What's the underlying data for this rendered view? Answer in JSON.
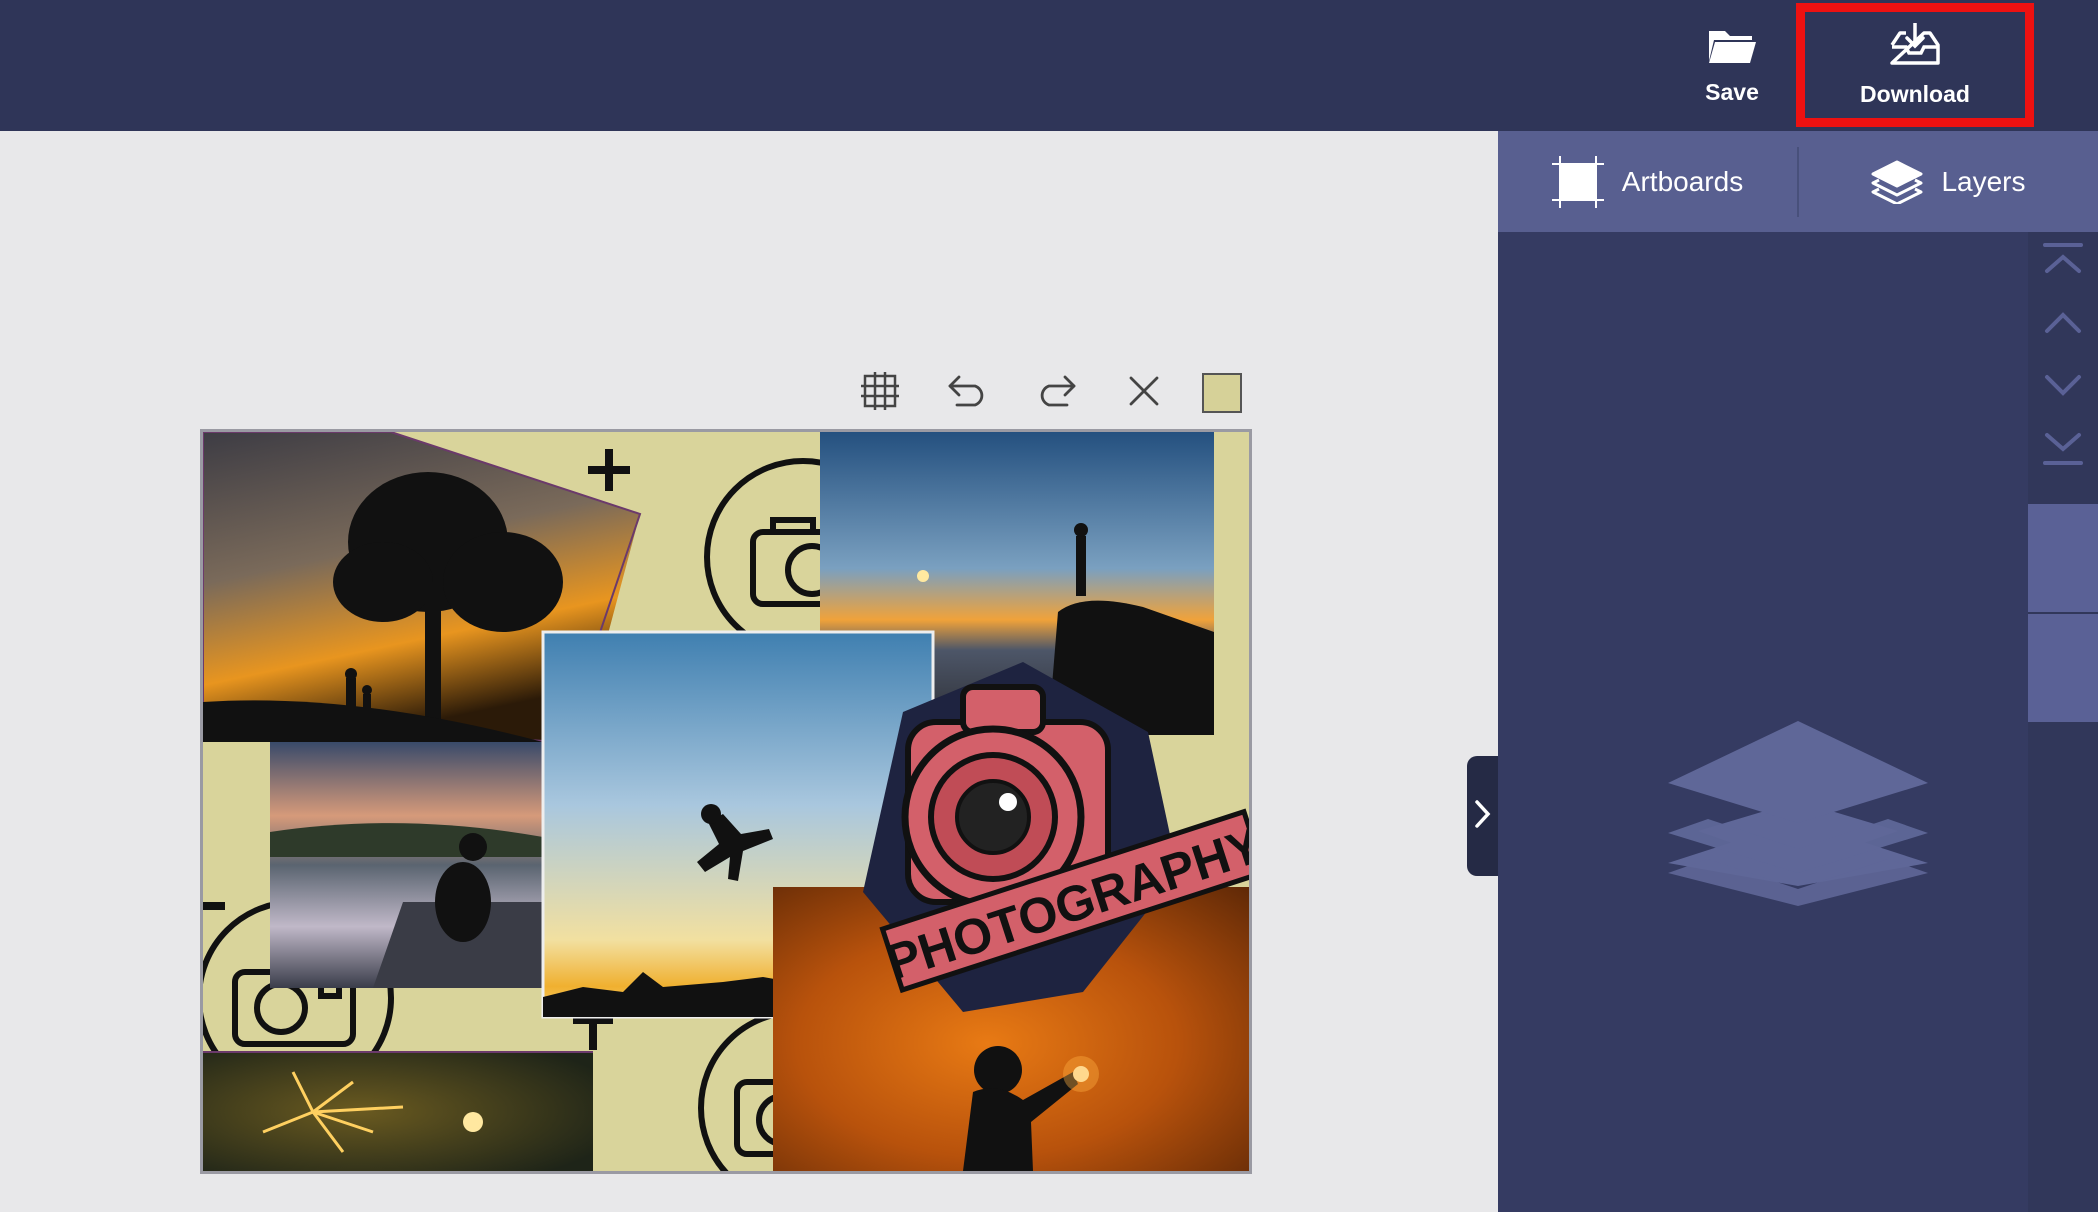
{
  "topbar": {
    "save_label": "Save",
    "download_label": "Download"
  },
  "panel": {
    "tabs": [
      {
        "label": "Artboards",
        "icon": "artboard-icon"
      },
      {
        "label": "Layers",
        "icon": "layers-icon"
      }
    ],
    "layer_controls": [
      "bring-to-front-icon",
      "move-up-icon",
      "move-down-icon",
      "send-to-back-icon"
    ]
  },
  "canvas_toolbar": [
    "grid-icon",
    "undo-icon",
    "redo-icon",
    "close-icon",
    "background-color-swatch"
  ],
  "artboard": {
    "logo_text": "PHOTOGRAPHY",
    "background_color": "#d9d49b"
  },
  "colors": {
    "topbar": "#2f3558",
    "panel": "#353b62",
    "tabs": "#585f90",
    "highlight": "#ee1111"
  }
}
